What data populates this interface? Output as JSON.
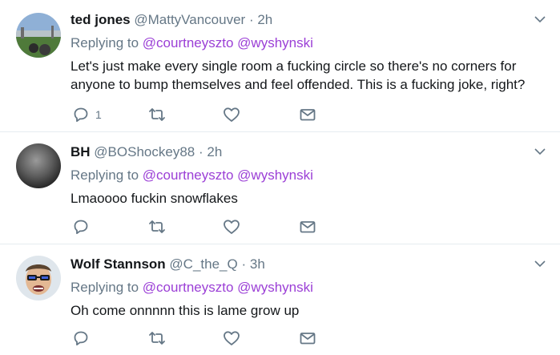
{
  "tweets": [
    {
      "name": "ted jones",
      "handle": "@MattyVancouver",
      "separator": "·",
      "time": "2h",
      "replying_prefix": "Replying to",
      "mentions": [
        "@courtneyszto",
        "@wyshynski"
      ],
      "text": "Let's just make every single room a fucking circle so there's no corners for anyone to bump themselves and feel offended. This is a fucking joke, right?",
      "reply_count": "1",
      "avatar_colors": [
        "#6f8fb3",
        "#5b7a45"
      ]
    },
    {
      "name": "BH",
      "handle": "@BOShockey88",
      "separator": "·",
      "time": "2h",
      "replying_prefix": "Replying to",
      "mentions": [
        "@courtneyszto",
        "@wyshynski"
      ],
      "text": "Lmaoooo fuckin snowflakes",
      "reply_count": "",
      "avatar_colors": [
        "#8d8d8d",
        "#2a2a2a"
      ]
    },
    {
      "name": "Wolf Stannson",
      "handle": "@C_the_Q",
      "separator": "·",
      "time": "3h",
      "replying_prefix": "Replying to",
      "mentions": [
        "@courtneyszto",
        "@wyshynski"
      ],
      "text": "Oh come onnnnn this is lame grow up",
      "reply_count": "",
      "avatar_colors": [
        "#e8c9a6",
        "#1b1b1b"
      ]
    }
  ],
  "icons": [
    "reply-icon",
    "retweet-icon",
    "like-icon",
    "dm-icon",
    "chevron-down-icon"
  ],
  "colors": {
    "mention": "#9b3fd6",
    "secondary": "#657786",
    "divider": "#e6ecf0"
  }
}
